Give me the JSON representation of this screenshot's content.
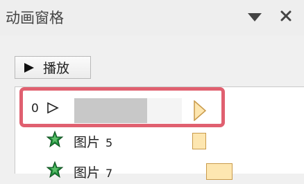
{
  "panel": {
    "title": "动画窗格",
    "dropdown_icon": "triangle-down-icon",
    "close_icon": "close-icon"
  },
  "toolbar": {
    "play_label": "播放",
    "play_icon": "play-icon"
  },
  "animation_list": {
    "trigger_row": {
      "number": "0",
      "trigger_icon": "play-outline-icon"
    },
    "items": [
      {
        "name": "图片",
        "number": "5",
        "effect_icon": "green-star-icon"
      },
      {
        "name": "图片",
        "number": "7",
        "effect_icon": "green-star-icon"
      }
    ]
  },
  "colors": {
    "highlight": "#e06070",
    "timeline_bar": "#fde6b0",
    "star": "#1e8a3a"
  }
}
